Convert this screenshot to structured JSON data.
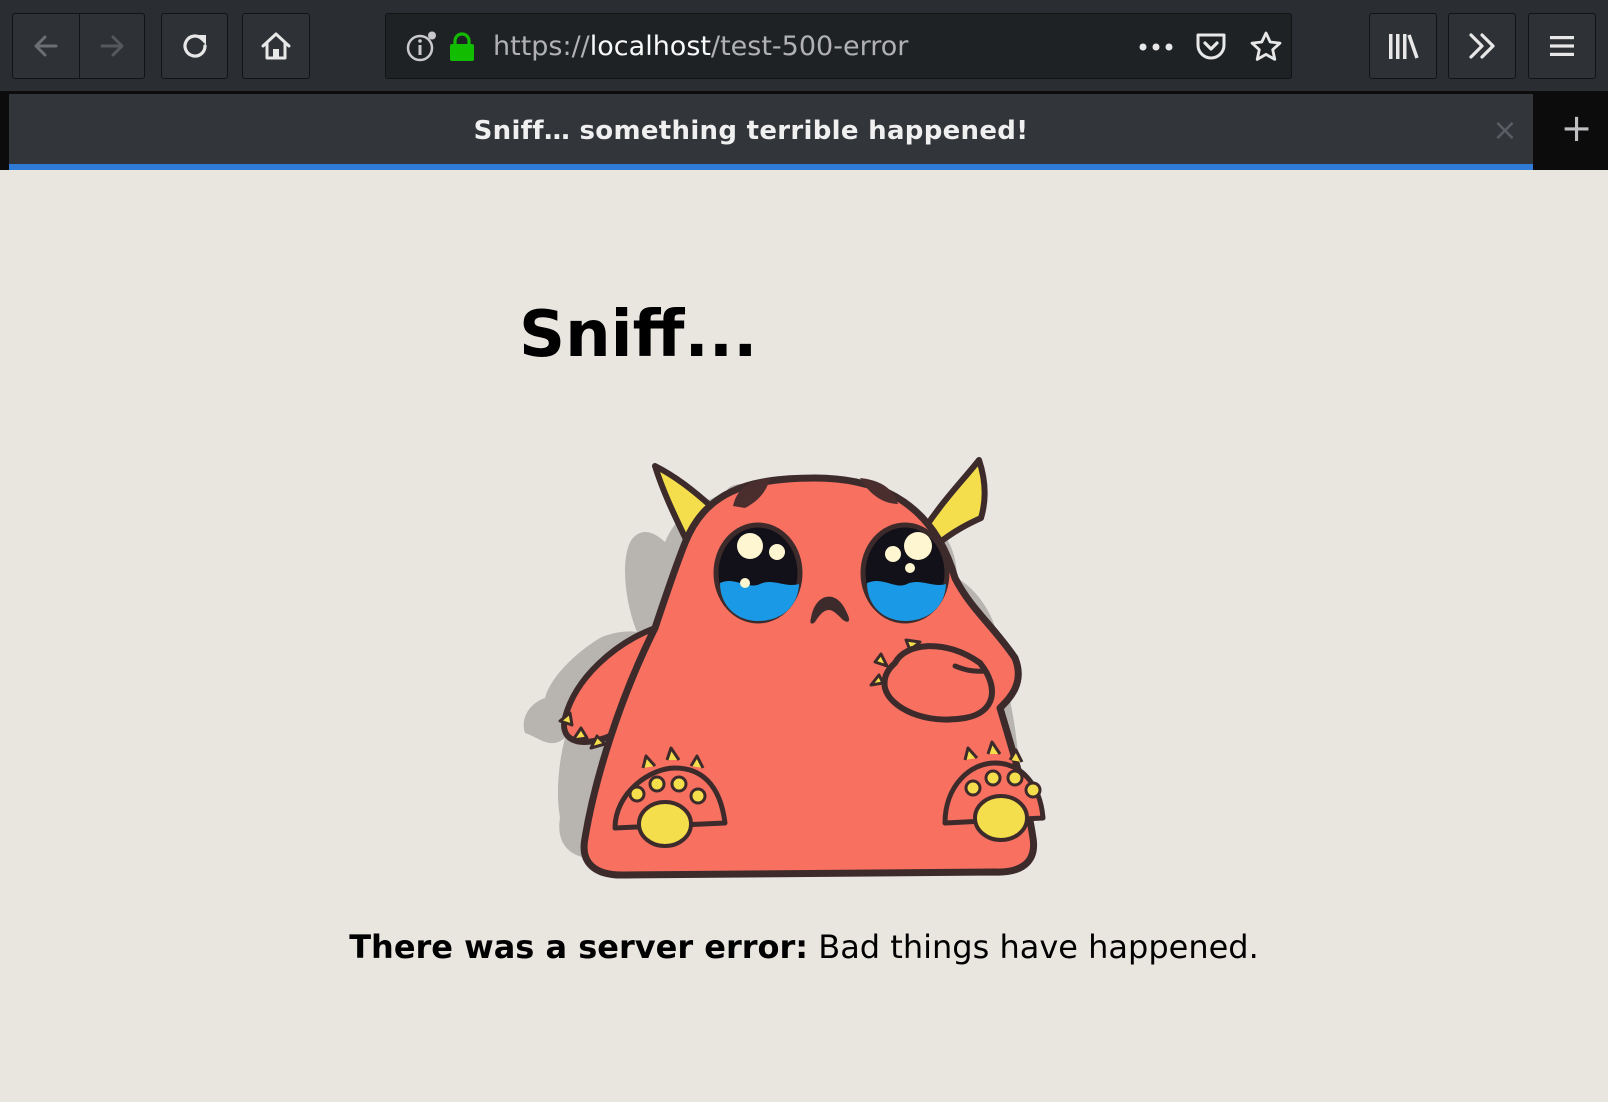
{
  "browser": {
    "url": {
      "scheme": "https://",
      "host": "localhost",
      "path": "/test-500-error"
    },
    "icons": {
      "back": "arrow-left-icon",
      "forward": "arrow-right-icon",
      "reload": "reload-icon",
      "home": "home-icon",
      "site_info": "info-icon",
      "secure": "lock-icon",
      "page_actions": "more-dots-icon",
      "pocket": "pocket-icon",
      "bookmark": "star-icon",
      "library": "library-icon",
      "overflow": "double-chevron-icon",
      "menu": "hamburger-menu-icon",
      "tab_close": "close-icon",
      "new_tab": "plus-icon"
    },
    "colors": {
      "toolbar": "#2a2d31",
      "tab_active_line": "#2f7bd8",
      "lock": "#12bc00"
    }
  },
  "tab": {
    "title": "Sniff… something terrible happened!",
    "close_glyph": "×",
    "new_tab_glyph": "+"
  },
  "page": {
    "heading": "Sniff...",
    "error_label": "There was a server error:",
    "error_detail": " Bad things have happened.",
    "illustration": "crying-monster-illustration",
    "colors": {
      "background": "#e9e6df",
      "monster_body": "#f87060",
      "monster_horns": "#f5de4c",
      "tears": "#1a9ae6"
    }
  }
}
